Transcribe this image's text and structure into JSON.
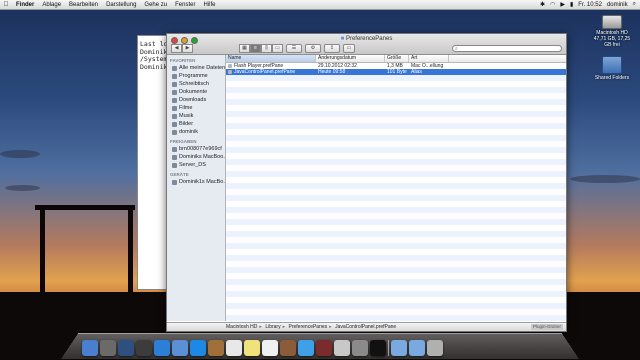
{
  "menubar": {
    "app": "Finder",
    "items": [
      "Ablage",
      "Bearbeiten",
      "Darstellung",
      "Gehe zu",
      "Fenster",
      "Hilfe"
    ],
    "clock": "Fr. 10:52",
    "user": "dominik"
  },
  "terminal": {
    "lines": [
      "Last lo",
      "Dominik",
      "/System",
      "Dominik"
    ]
  },
  "finder": {
    "title": "PreferencePanes",
    "search_placeholder": "",
    "sidebar": {
      "favorites_header": "FAVORITEN",
      "favorites": [
        "Alle meine Dateien",
        "Programme",
        "Schreibtisch",
        "Dokumente",
        "Downloads",
        "Filme",
        "Musik",
        "Bilder",
        "dominik"
      ],
      "shared_header": "FREIGABEN",
      "shared": [
        "brn008077e969cf",
        "Dominiks MacBoo...",
        "Server_DS"
      ],
      "devices_header": "GERÄTE",
      "devices": [
        "Dominik1s MacBo..."
      ]
    },
    "columns": {
      "name": "Name",
      "date": "Änderungsdatum",
      "size": "Größe",
      "kind": "Art"
    },
    "files": [
      {
        "name": "Flash Player.prefPane",
        "date": "29.10.2012 02:32",
        "size": "1,3 MB",
        "kind": "Mac O...ellung"
      },
      {
        "name": "JavaControlPanel.prefPane",
        "date": "Heute 09:58",
        "size": "101 Byte",
        "kind": "Alias"
      }
    ],
    "path": [
      "Macintosh HD",
      "Library",
      "PreferencePanes",
      "JavaControlPanel.prefPane"
    ],
    "resize_label": "Plugin-Ordner"
  },
  "desktop": {
    "icons": [
      {
        "label1": "Macintosh HD",
        "label2": "47,71 GB, 17,25 GB frei"
      },
      {
        "label1": "Shared Folders",
        "label2": ""
      }
    ]
  },
  "dock": {
    "items": [
      "finder-icon",
      "launchpad-icon",
      "mission-control-icon",
      "dashboard-icon",
      "app-store-icon",
      "mail-icon",
      "safari-icon",
      "contacts-icon",
      "calendar-icon",
      "notes-icon",
      "reminders-icon",
      "photo-icon",
      "itunes-icon",
      "photo-booth-icon",
      "preview-icon",
      "system-preferences-icon",
      "terminal-icon",
      "folder-icon",
      "downloads-icon",
      "trash-icon"
    ],
    "colors": [
      "#4a7fd0",
      "#6a6a6a",
      "#2f4f7f",
      "#3c3c3c",
      "#2c7fd6",
      "#5b8fd6",
      "#1e88e5",
      "#a0703a",
      "#e8e8e8",
      "#f0e27a",
      "#f0f0f0",
      "#8c5b3a",
      "#3fa0e8",
      "#7a2b2b",
      "#c8c8c8",
      "#8a8a8a",
      "#111111",
      "#7aa8e0",
      "#7aa8e0",
      "#b0b0b0"
    ]
  }
}
